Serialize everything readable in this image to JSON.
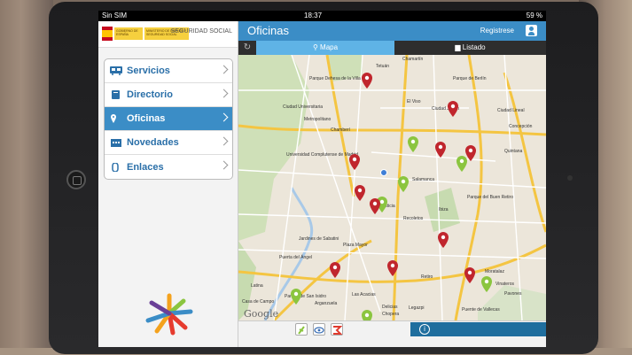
{
  "status_bar": {
    "carrier": "Sin SIM",
    "time": "18:37",
    "battery": "59 %"
  },
  "header": {
    "ministry": "SEGURIDAD SOCIAL",
    "gov_label": "GOBIERNO DE ESPAÑA",
    "ministry_label": "MINISTERIO DE EMPLEO Y SEGURIDAD SOCIAL"
  },
  "sidebar": {
    "items": [
      {
        "label": "Servicios",
        "icon": "bus-icon",
        "active": false
      },
      {
        "label": "Directorio",
        "icon": "book-icon",
        "active": false
      },
      {
        "label": "Oficinas",
        "icon": "location-pin-icon",
        "active": true
      },
      {
        "label": "Novedades",
        "icon": "calendar-icon",
        "active": false
      },
      {
        "label": "Enlaces",
        "icon": "paperclip-icon",
        "active": false
      }
    ]
  },
  "main": {
    "title": "Oficinas",
    "register_label": "Registrese",
    "tabs": [
      {
        "label": "Mapa",
        "icon": "location-pin-icon"
      },
      {
        "label": "Listado",
        "icon": "document-icon"
      }
    ],
    "map_labels": [
      "Tetuán",
      "Chamartín",
      "Parque Dehesa de la Villa",
      "Parque de Berlín",
      "El Viso",
      "Ciudad Universitaria",
      "Ciudad Jardín",
      "Ciudad Lineal",
      "Concepción",
      "Metropolitano",
      "Chamberí",
      "Quintana",
      "Universidad Complutense de Madrid",
      "Salamanca",
      "Ibiza",
      "Parque del Buen Retiro",
      "Plaza Mayor",
      "Jardines de Sabatini",
      "Puerta del Ángel",
      "Retiro",
      "Moratalaz",
      "Vinateros",
      "Pavones",
      "Las Acacias",
      "Arganzuela",
      "Delicias",
      "Chopera",
      "Legazpi",
      "Puente de Vallecas",
      "Latina",
      "Parque de San Isidro",
      "Casa de Campo",
      "Justicia",
      "Recoletos"
    ],
    "google_label": "Google"
  },
  "colors": {
    "accent": "#3b8dc6",
    "tab_active": "#5fb3e6",
    "pin_red": "#c0262d",
    "pin_green": "#8bc53f"
  }
}
